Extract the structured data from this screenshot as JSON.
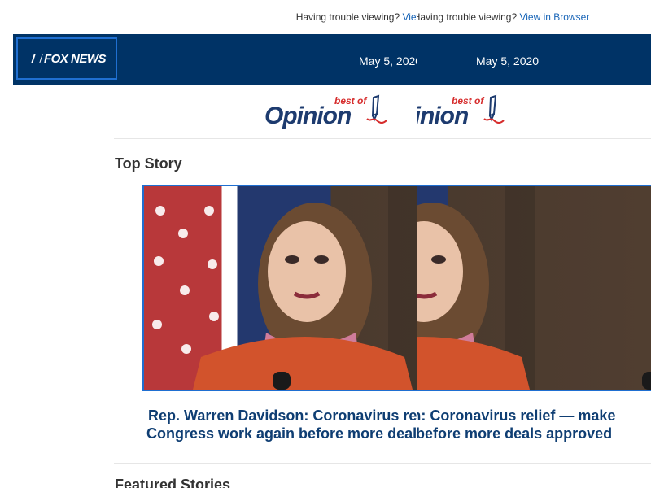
{
  "top_bar": {
    "trouble_text": "Having trouble viewing?",
    "view_link": "View in Browser"
  },
  "header": {
    "logo": "FOX NEWS",
    "date": "May 5, 2020"
  },
  "branding": {
    "best_of": "best of",
    "opinion": "Opinion"
  },
  "sections": {
    "top_story": "Top Story",
    "featured": "Featured Stories"
  },
  "top_story": {
    "headline_line1": "Rep. Warren Davidson: Coronavirus relief — make",
    "headline_line2": "Congress work again before more deals approved"
  },
  "colors": {
    "header_bg": "#003366",
    "link": "#1a66b8",
    "headline": "#0f3e73",
    "accent_border": "#1f6fd1"
  }
}
